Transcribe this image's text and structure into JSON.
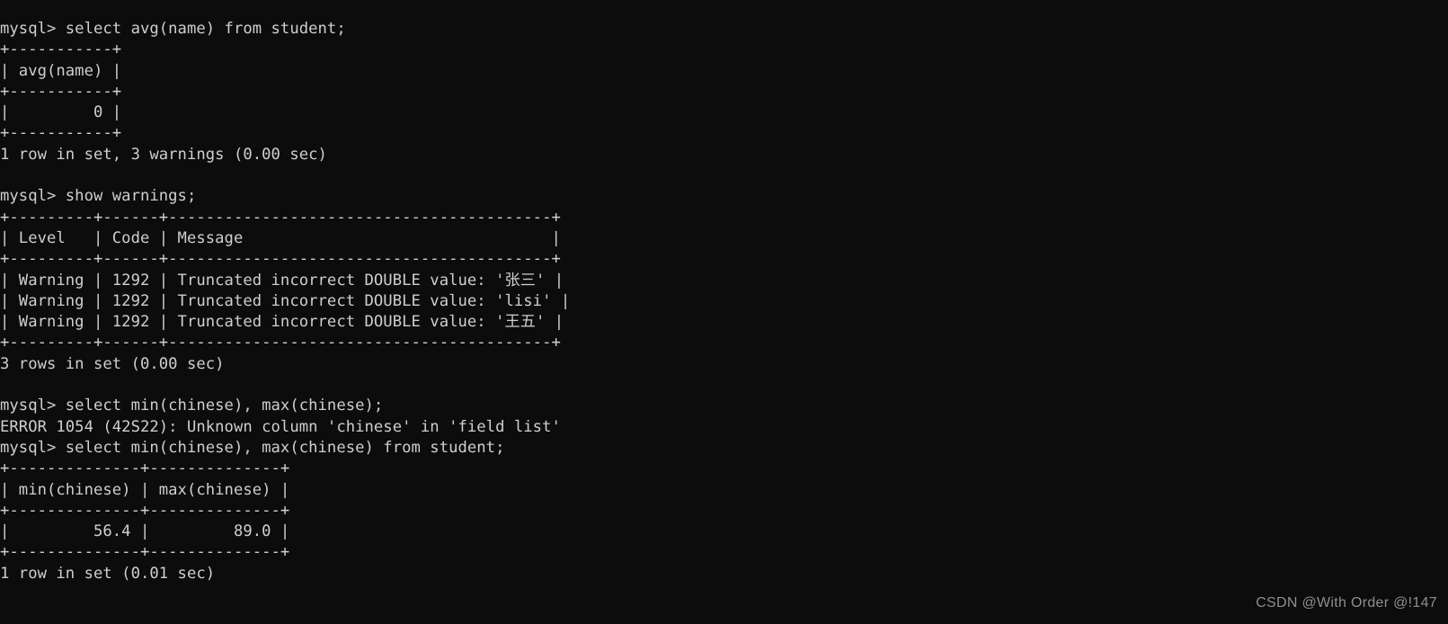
{
  "terminal": {
    "title": "mysql-client-terminal",
    "background_color": "#0c0c0c",
    "text_color": "#cfcfcf",
    "prompt": "mysql>",
    "lines": [
      "mysql> select avg(name) from student;",
      "+-----------+",
      "| avg(name) |",
      "+-----------+",
      "|         0 |",
      "+-----------+",
      "1 row in set, 3 warnings (0.00 sec)",
      "",
      "mysql> show warnings;",
      "+---------+------+-----------------------------------------+",
      "| Level   | Code | Message                                 |",
      "+---------+------+-----------------------------------------+",
      "| Warning | 1292 | Truncated incorrect DOUBLE value: '张三' |",
      "| Warning | 1292 | Truncated incorrect DOUBLE value: 'lisi' |",
      "| Warning | 1292 | Truncated incorrect DOUBLE value: '王五' |",
      "+---------+------+-----------------------------------------+",
      "3 rows in set (0.00 sec)",
      "",
      "mysql> select min(chinese), max(chinese);",
      "ERROR 1054 (42S22): Unknown column 'chinese' in 'field list'",
      "mysql> select min(chinese), max(chinese) from student;",
      "+--------------+--------------+",
      "| min(chinese) | max(chinese) |",
      "+--------------+--------------+",
      "|         56.4 |         89.0 |",
      "+--------------+--------------+",
      "1 row in set (0.01 sec)"
    ],
    "commands": [
      "select avg(name) from student;",
      "show warnings;",
      "select min(chinese), max(chinese);",
      "select min(chinese), max(chinese) from student;"
    ],
    "results": {
      "avg_table": {
        "columns": [
          "avg(name)"
        ],
        "rows": [
          [
            "0"
          ]
        ],
        "status": "1 row in set, 3 warnings (0.00 sec)"
      },
      "warnings_table": {
        "columns": [
          "Level",
          "Code",
          "Message"
        ],
        "rows": [
          [
            "Warning",
            "1292",
            "Truncated incorrect DOUBLE value: '张三'"
          ],
          [
            "Warning",
            "1292",
            "Truncated incorrect DOUBLE value: 'lisi'"
          ],
          [
            "Warning",
            "1292",
            "Truncated incorrect DOUBLE value: '王五'"
          ]
        ],
        "status": "3 rows in set (0.00 sec)"
      },
      "minmax_table": {
        "columns": [
          "min(chinese)",
          "max(chinese)"
        ],
        "rows": [
          [
            "56.4",
            "89.0"
          ]
        ],
        "status": "1 row in set (0.01 sec)"
      }
    },
    "errors": [
      "ERROR 1054 (42S22): Unknown column 'chinese' in 'field list'"
    ]
  },
  "watermark": {
    "text": "CSDN @With Order @!147"
  }
}
